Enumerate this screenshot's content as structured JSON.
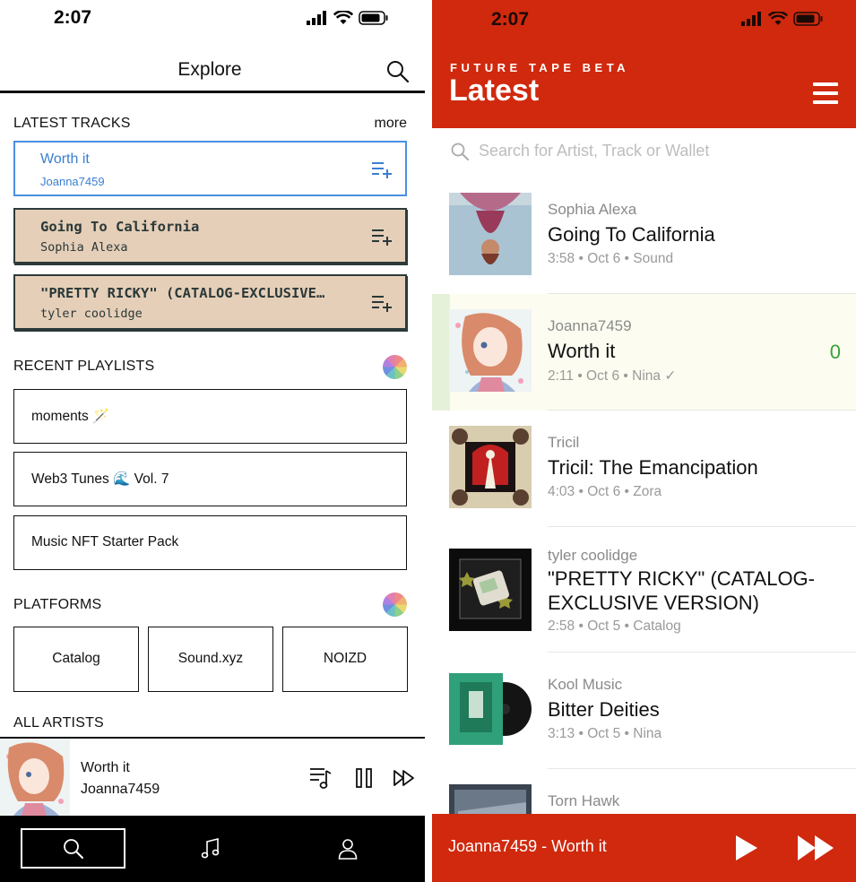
{
  "left": {
    "status": {
      "time": "2:07"
    },
    "header": {
      "title": "Explore"
    },
    "latest_tracks": {
      "heading": "LATEST TRACKS",
      "more_label": "more",
      "items": [
        {
          "title": "Worth it",
          "artist": "Joanna7459"
        },
        {
          "title": "Going To California",
          "artist": "Sophia Alexa"
        },
        {
          "title": "\"PRETTY RICKY\" (CATALOG-EXCLUSIVE…",
          "artist": "tyler coolidge"
        }
      ]
    },
    "recent_playlists": {
      "heading": "RECENT PLAYLISTS",
      "items": [
        {
          "name": "moments 🪄"
        },
        {
          "name": "Web3 Tunes 🌊 Vol. 7"
        },
        {
          "name": "Music NFT Starter Pack"
        }
      ]
    },
    "platforms": {
      "heading": "PLATFORMS",
      "items": [
        "Catalog",
        "Sound.xyz",
        "NOIZD"
      ]
    },
    "all_artists": {
      "heading": "ALL ARTISTS"
    },
    "mini_player": {
      "title": "Worth it",
      "artist": "Joanna7459"
    }
  },
  "right": {
    "status": {
      "time": "2:07"
    },
    "header": {
      "brand": "FUTURE TAPE BETA",
      "title": "Latest"
    },
    "search": {
      "placeholder": "Search for Artist, Track or Wallet"
    },
    "tracks": [
      {
        "artist": "Sophia Alexa",
        "title": "Going To California",
        "meta": "3:58 • Oct 6 • Sound"
      },
      {
        "artist": "Joanna7459",
        "title": "Worth it",
        "meta": "2:11 • Oct 6 • Nina ✓",
        "count": "0"
      },
      {
        "artist": "Tricil",
        "title": "Tricil: The Emancipation",
        "meta": "4:03 • Oct 6 • Zora"
      },
      {
        "artist": "tyler coolidge",
        "title": "\"PRETTY RICKY\" (CATALOG-EXCLUSIVE VERSION)",
        "meta": "2:58 • Oct 5 • Catalog"
      },
      {
        "artist": "Kool Music",
        "title": "Bitter Deities",
        "meta": "3:13 • Oct 5 • Nina"
      },
      {
        "artist": "Torn Hawk",
        "title": "",
        "meta": ""
      }
    ],
    "player": {
      "now_playing": "Joanna7459 - Worth it"
    }
  },
  "colors": {
    "accent_red": "#d0290e",
    "tan": "#e5cfb8",
    "link_blue": "#3a7fd0",
    "count_green": "#3aa03a"
  }
}
